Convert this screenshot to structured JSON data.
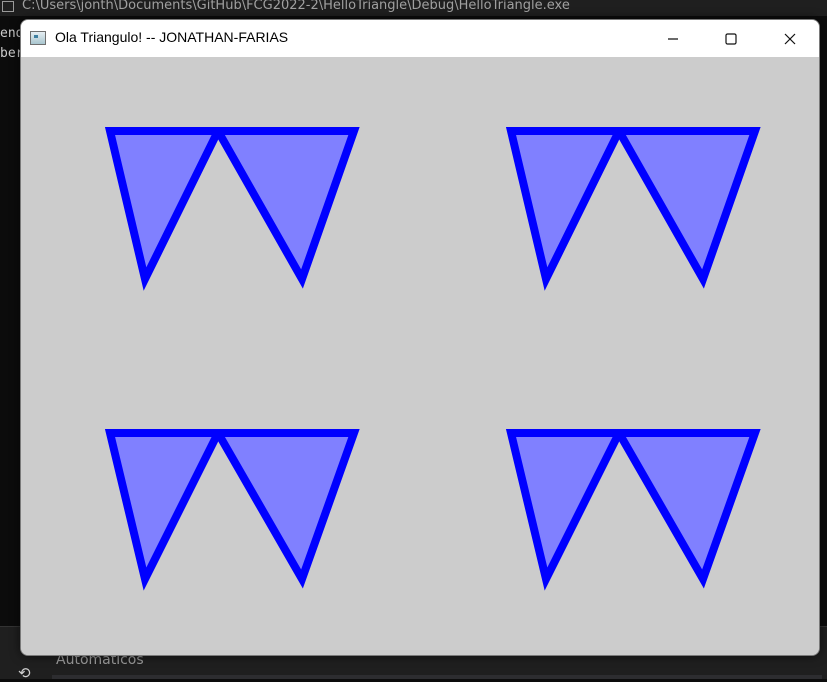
{
  "console_window": {
    "title": "C:\\Users\\jonth\\Documents\\GitHub\\FCG2022-2\\HelloTriangle\\Debug\\HelloTriangle.exe",
    "lines": [
      "end",
      "ber"
    ]
  },
  "background_panel": {
    "label": "Automáticos",
    "undo_glyph": "⟲"
  },
  "gl_window": {
    "title": "Ola Triangulo! -- JONATHAN-FARIAS",
    "minimize_glyph": "—",
    "maximize_glyph": "☐",
    "close_glyph": "✕",
    "canvas": {
      "clear_color": "#cccccc",
      "fill_color": "#8080ff",
      "outline_color": "#0000ff",
      "quadrants": [
        "top-left",
        "top-right",
        "bottom-left",
        "bottom-right"
      ],
      "triangles_per_quadrant": 2
    }
  }
}
